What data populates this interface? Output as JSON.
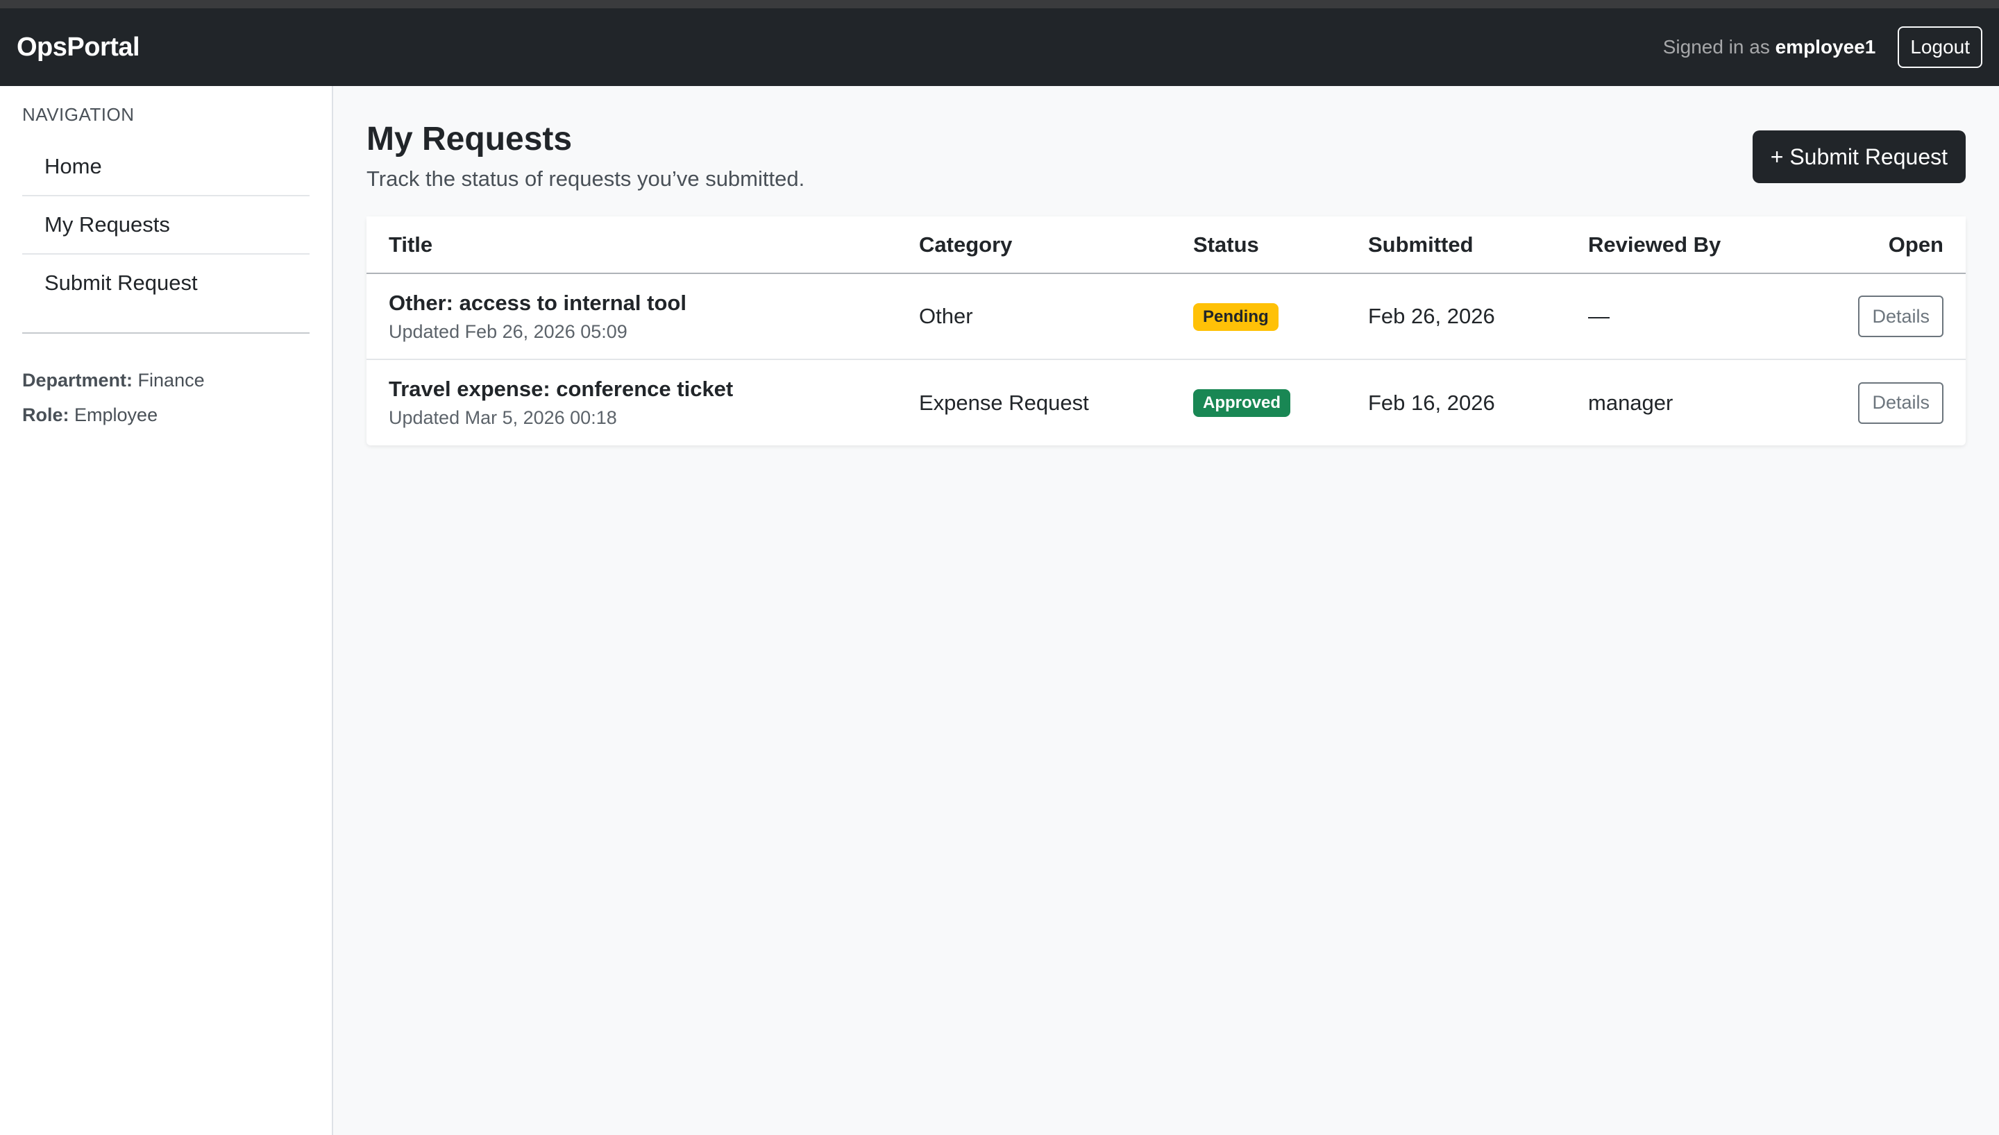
{
  "app": {
    "brand": "OpsPortal"
  },
  "header": {
    "signed_in_prefix": "Signed in as ",
    "username": "employee1",
    "logout_label": "Logout"
  },
  "sidebar": {
    "heading": "NAVIGATION",
    "items": [
      {
        "label": "Home"
      },
      {
        "label": "My Requests"
      },
      {
        "label": "Submit Request"
      }
    ],
    "department_label": "Department:",
    "department_value": "Finance",
    "role_label": "Role:",
    "role_value": "Employee"
  },
  "main": {
    "title": "My Requests",
    "subtitle": "Track the status of requests you’ve submitted.",
    "submit_button": "+ Submit Request",
    "table": {
      "columns": [
        "Title",
        "Category",
        "Status",
        "Submitted",
        "Reviewed By",
        "Open"
      ],
      "rows": [
        {
          "title": "Other: access to internal tool",
          "updated": "Updated Feb 26, 2026 05:09",
          "category": "Other",
          "status": "Pending",
          "submitted": "Feb 26, 2026",
          "reviewed_by": "—",
          "action": "Details"
        },
        {
          "title": "Travel expense: conference ticket",
          "updated": "Updated Mar 5, 2026 00:18",
          "category": "Expense Request",
          "status": "Approved",
          "submitted": "Feb 16, 2026",
          "reviewed_by": "manager",
          "action": "Details"
        }
      ]
    }
  },
  "colors": {
    "navbar": "#212529",
    "pending": "#ffc107",
    "approved": "#198754"
  }
}
